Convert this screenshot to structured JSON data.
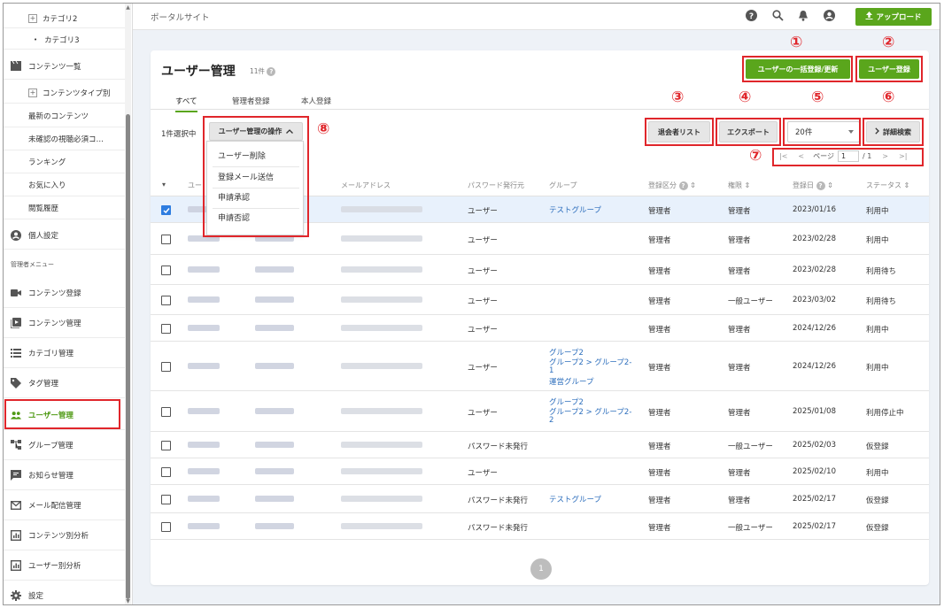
{
  "sidebar": {
    "items": [
      {
        "label": "カテゴリ2",
        "type": "sub-plus"
      },
      {
        "label": "カテゴリ3",
        "type": "sub-dot"
      },
      {
        "label": "コンテンツ一覧",
        "icon": "clapper-icon"
      },
      {
        "label": "コンテンツタイプ別",
        "type": "sub-plus"
      },
      {
        "label": "最新のコンテンツ",
        "type": "plain"
      },
      {
        "label": "未確認の視聴必須コ…",
        "type": "plain"
      },
      {
        "label": "ランキング",
        "type": "plain"
      },
      {
        "label": "お気に入り",
        "type": "plain"
      },
      {
        "label": "閲覧履歴",
        "type": "plain"
      },
      {
        "label": "個人設定",
        "icon": "account-icon"
      }
    ],
    "admin_section_label": "管理者メニュー",
    "admin_items": [
      {
        "label": "コンテンツ登録",
        "icon": "video-add-icon"
      },
      {
        "label": "コンテンツ管理",
        "icon": "play-library-icon"
      },
      {
        "label": "カテゴリ管理",
        "icon": "list-icon"
      },
      {
        "label": "タグ管理",
        "icon": "tag-icon"
      },
      {
        "label": "ユーザー管理",
        "icon": "users-icon",
        "active": true
      },
      {
        "label": "グループ管理",
        "icon": "hierarchy-icon"
      },
      {
        "label": "お知らせ管理",
        "icon": "notice-icon"
      },
      {
        "label": "メール配信管理",
        "icon": "mail-icon"
      },
      {
        "label": "コンテンツ別分析",
        "icon": "chart-icon"
      },
      {
        "label": "ユーザー別分析",
        "icon": "chart-icon"
      },
      {
        "label": "設定",
        "icon": "gear-icon"
      }
    ]
  },
  "header": {
    "site_title": "ポータルサイト",
    "upload_label": "アップロード"
  },
  "main": {
    "title": "ユーザー管理",
    "count": "11件",
    "tabs": [
      "すべて",
      "管理者登録",
      "本人登録"
    ],
    "bulk_button": "ユーザーの一括登録/更新",
    "register_button": "ユーザー登録",
    "selected_text": "1件選択中",
    "ops_button": "ユーザー管理の操作",
    "ops_menu": [
      "ユーザー削除",
      "登録メール送信",
      "申請承認",
      "申請否認"
    ],
    "withdrawn_button": "退会者リスト",
    "export_button": "エクスポート",
    "per_page": "20件",
    "advanced_search": "詳細検索",
    "pager_page_label": "ページ",
    "pager_current": "1",
    "pager_total": "/ 1",
    "columns": [
      "ユー",
      "メールアドレス",
      "パスワード発行元",
      "グループ",
      "登録区分",
      "権限",
      "登録日",
      "ステータス"
    ],
    "rows": [
      {
        "pw": "ユーザー",
        "groups": [
          "テストグループ"
        ],
        "kubun": "管理者",
        "kengen": "管理者",
        "date": "2023/01/16",
        "status": "利用中",
        "selected": true
      },
      {
        "pw": "ユーザー",
        "groups": [],
        "kubun": "管理者",
        "kengen": "管理者",
        "date": "2023/02/28",
        "status": "利用中"
      },
      {
        "pw": "ユーザー",
        "groups": [],
        "kubun": "管理者",
        "kengen": "管理者",
        "date": "2023/02/28",
        "status": "利用待ち"
      },
      {
        "pw": "ユーザー",
        "groups": [],
        "kubun": "管理者",
        "kengen": "一般ユーザー",
        "date": "2023/03/02",
        "status": "利用待ち"
      },
      {
        "pw": "ユーザー",
        "groups": [],
        "kubun": "管理者",
        "kengen": "管理者",
        "date": "2024/12/26",
        "status": "利用中"
      },
      {
        "pw": "ユーザー",
        "groups": [
          "グループ2",
          "グループ2 > グループ2-",
          "1",
          "運営グループ"
        ],
        "kubun": "管理者",
        "kengen": "管理者",
        "date": "2024/12/26",
        "status": "利用中"
      },
      {
        "pw": "ユーザー",
        "groups": [
          "グループ2",
          "グループ2 > グループ2-",
          "2"
        ],
        "kubun": "管理者",
        "kengen": "管理者",
        "date": "2025/01/08",
        "status": "利用停止中"
      },
      {
        "pw": "パスワード未発行",
        "groups": [],
        "kubun": "管理者",
        "kengen": "一般ユーザー",
        "date": "2025/02/03",
        "status": "仮登録"
      },
      {
        "pw": "ユーザー",
        "groups": [],
        "kubun": "管理者",
        "kengen": "管理者",
        "date": "2025/02/10",
        "status": "利用中"
      },
      {
        "pw": "パスワード未発行",
        "groups": [
          "テストグループ"
        ],
        "kubun": "管理者",
        "kengen": "管理者",
        "date": "2025/02/17",
        "status": "仮登録"
      },
      {
        "pw": "パスワード未発行",
        "groups": [],
        "kubun": "管理者",
        "kengen": "一般ユーザー",
        "date": "2025/02/17",
        "status": "仮登録"
      }
    ],
    "bottom_page": "1"
  },
  "annotations": [
    "①",
    "②",
    "③",
    "④",
    "⑤",
    "⑥",
    "⑦",
    "⑧"
  ],
  "colors": {
    "accent": "#5aa61c",
    "annotation": "#e0262b",
    "link": "#2e6fbd",
    "selected_row": "#e8f1fc"
  }
}
